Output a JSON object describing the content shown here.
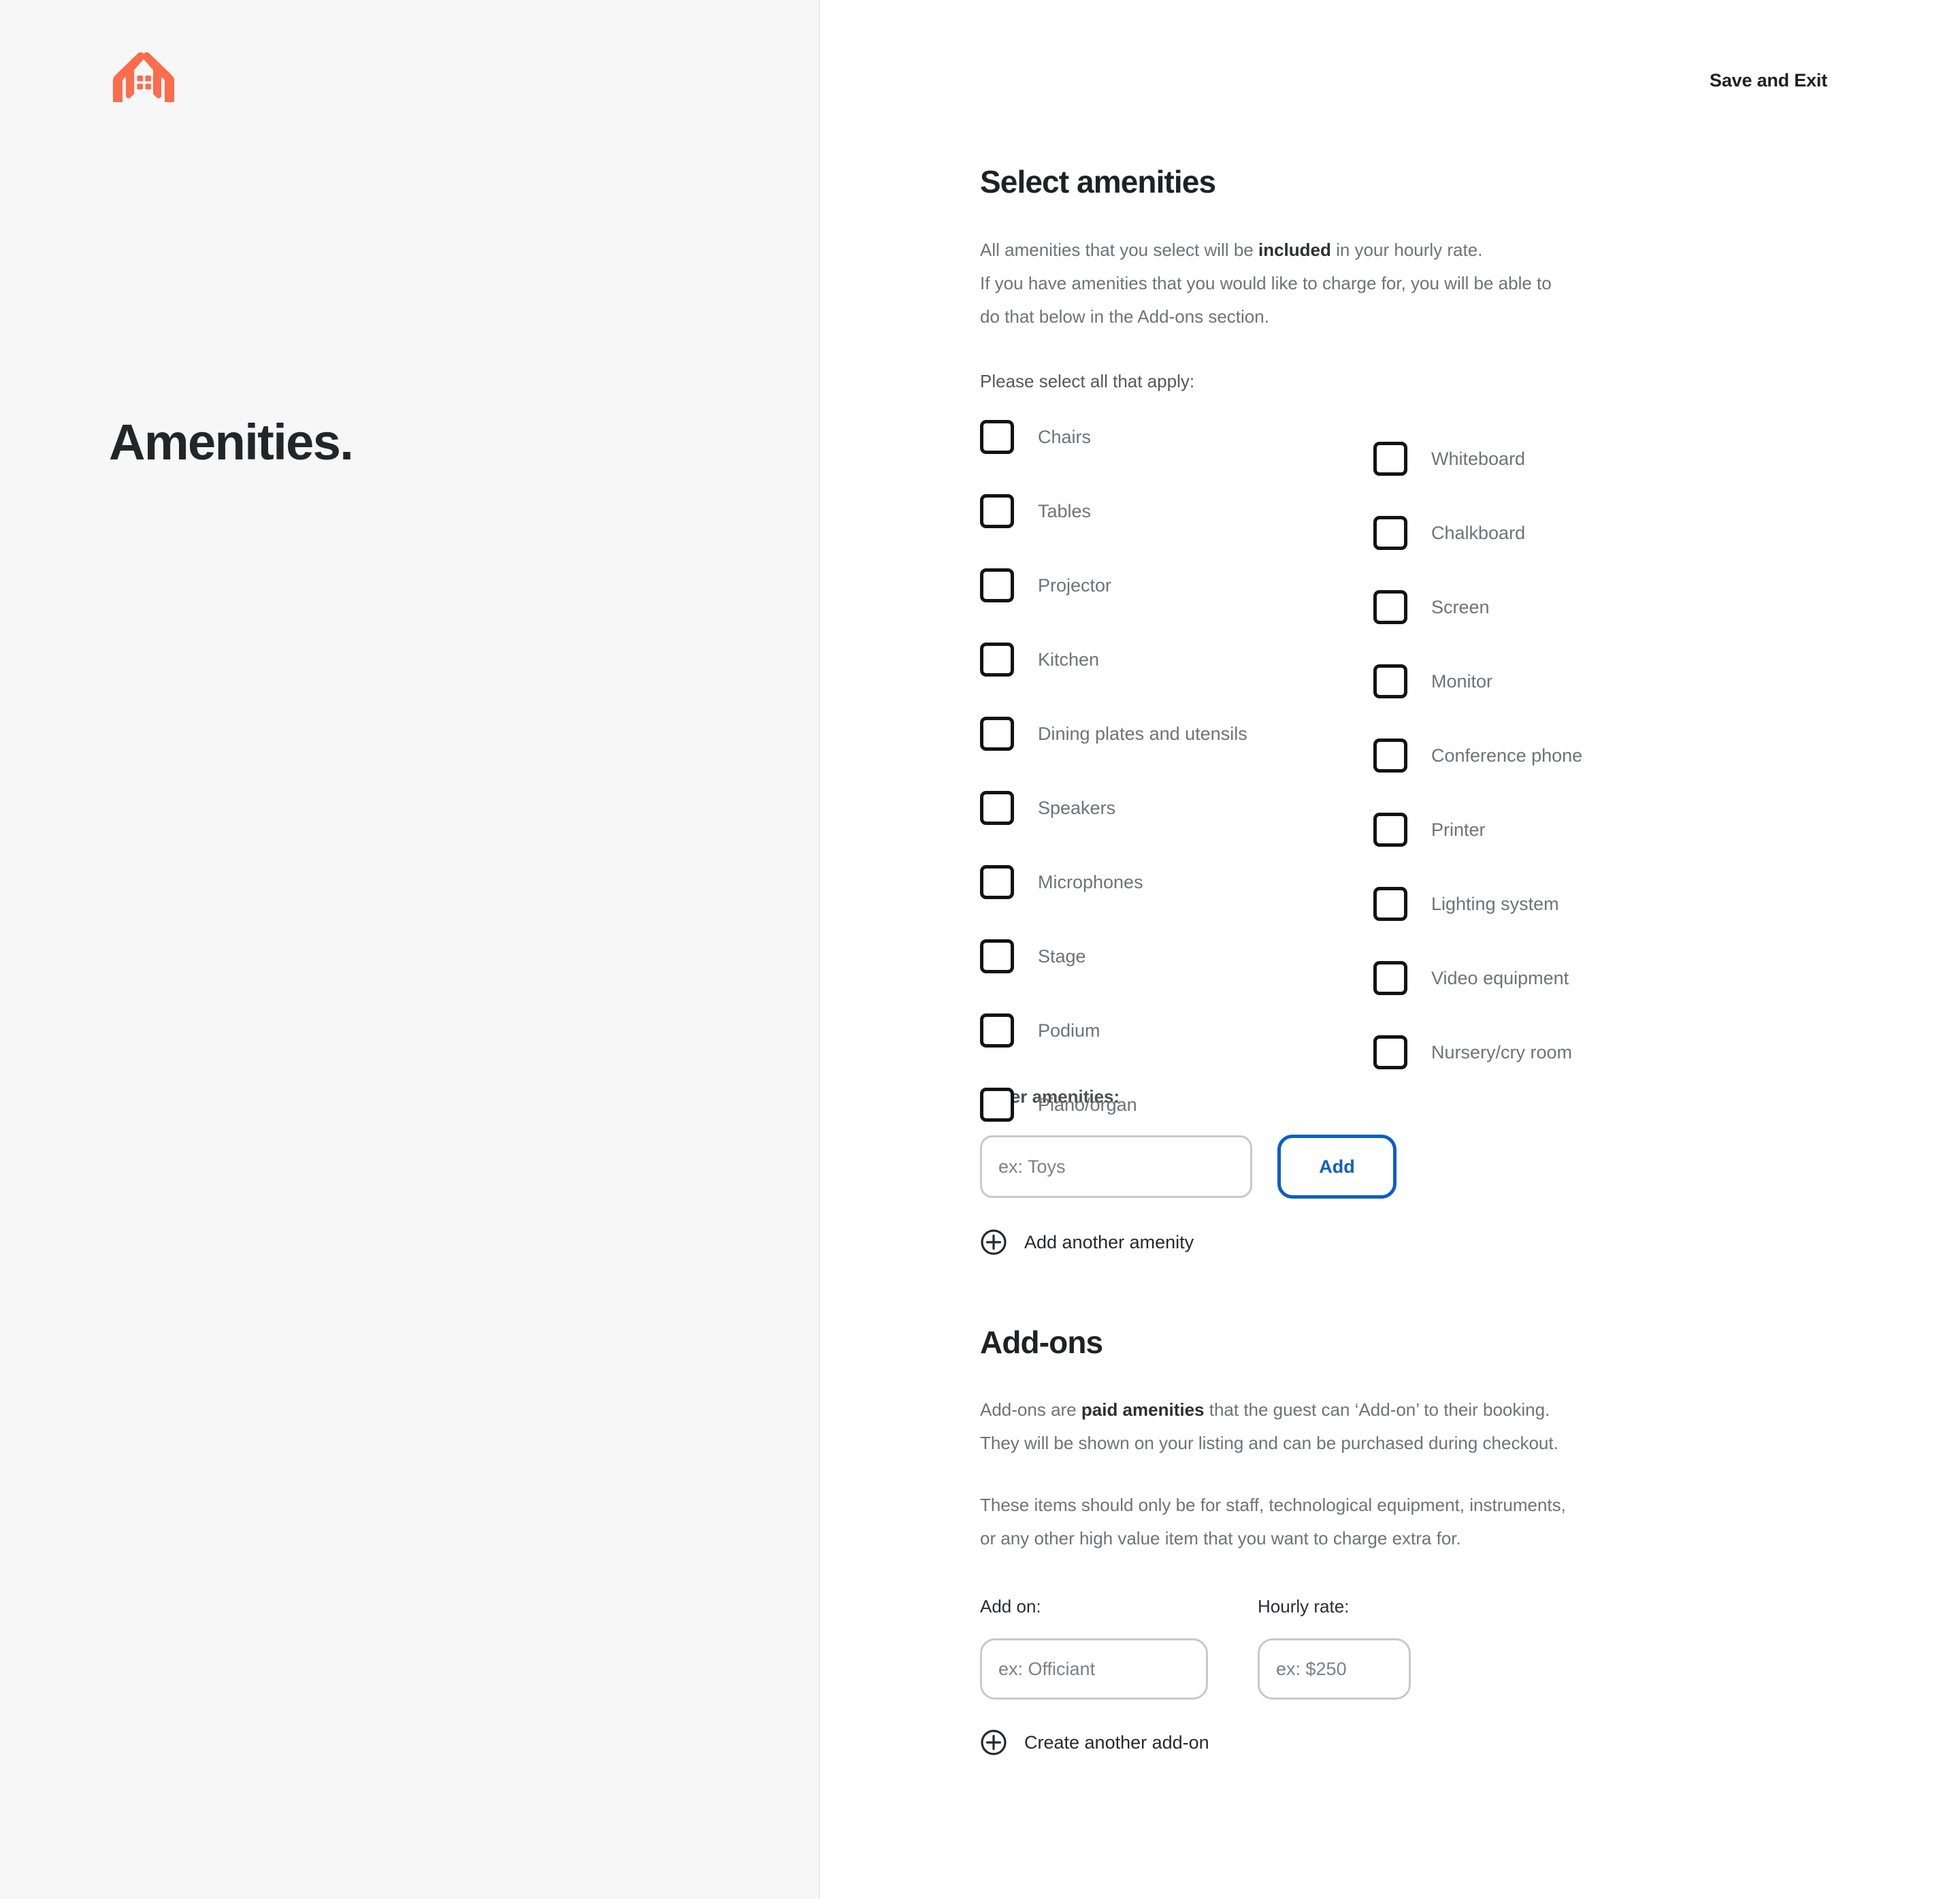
{
  "brand": {
    "logo_icon": "hands-house-logo-icon",
    "logo_color": "#fb6d4c"
  },
  "left_panel": {
    "title": "Amenities."
  },
  "header": {
    "save_and_exit_label": "Save and Exit"
  },
  "amenities_section": {
    "heading": "Select amenities",
    "intro_line1_pre": "All amenities that you select will be ",
    "intro_line1_bold": "included",
    "intro_line1_post": " in your hourly rate.",
    "intro_line2": "If you have amenities that you would like to charge for, you will be able to",
    "intro_line3": "do that below in the Add-ons section.",
    "select_all_label": "Please select all that apply:",
    "left_column": [
      {
        "label": "Chairs",
        "checked": false
      },
      {
        "label": "Tables",
        "checked": false
      },
      {
        "label": "Projector",
        "checked": false
      },
      {
        "label": "Kitchen",
        "checked": false
      },
      {
        "label": "Dining plates and utensils",
        "checked": false
      },
      {
        "label": "Speakers",
        "checked": false
      },
      {
        "label": "Microphones",
        "checked": false
      },
      {
        "label": "Stage",
        "checked": false
      },
      {
        "label": "Podium",
        "checked": false
      },
      {
        "label": "Piano/organ",
        "checked": false
      }
    ],
    "right_column": [
      {
        "label": "Whiteboard",
        "checked": false
      },
      {
        "label": "Chalkboard",
        "checked": false
      },
      {
        "label": "Screen",
        "checked": false
      },
      {
        "label": "Monitor",
        "checked": false
      },
      {
        "label": "Conference phone",
        "checked": false
      },
      {
        "label": "Printer",
        "checked": false
      },
      {
        "label": "Lighting system",
        "checked": false
      },
      {
        "label": "Video equipment",
        "checked": false
      },
      {
        "label": "Nursery/cry room",
        "checked": false
      }
    ],
    "other_label": "Other amenities:",
    "other_input_value": "",
    "other_input_placeholder": "ex: Toys",
    "add_button_label": "Add",
    "add_button_color": "#0a5fc4",
    "add_another_label": "Add another amenity",
    "add_another_icon": "plus-circle-icon"
  },
  "addons_section": {
    "heading": "Add-ons",
    "p1_pre": "Add-ons are ",
    "p1_bold": "paid amenities",
    "p1_post": " that the guest can ‘Add-on’ to their booking.",
    "p1_line2": "They will be shown on your listing and can be purchased during checkout.",
    "p2_line1": "These items should only be for staff, technological equipment, instruments,",
    "p2_line2": "or any other high value item that you want to charge extra for.",
    "addon_label": "Add on:",
    "addon_input_value": "",
    "addon_input_placeholder": "ex: Officiant",
    "rate_label": "Hourly rate:",
    "rate_input_value": "",
    "rate_input_placeholder": "ex: $250",
    "create_another_label": "Create another add-on",
    "create_another_icon": "plus-circle-icon"
  }
}
